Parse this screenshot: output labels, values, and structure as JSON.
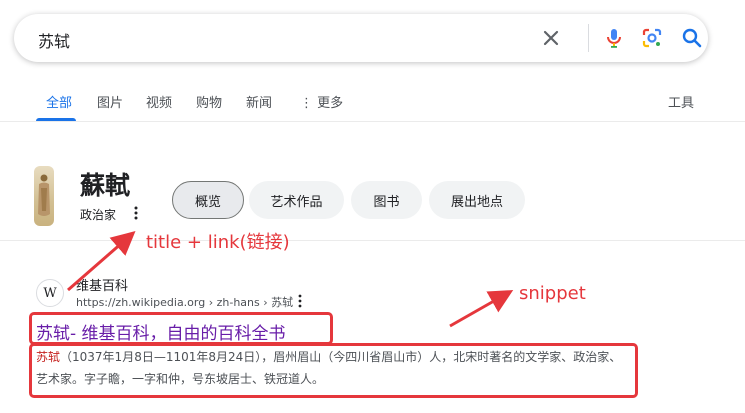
{
  "search": {
    "query": "苏轼"
  },
  "tabs": [
    {
      "label": "全部",
      "active": true
    },
    {
      "label": "图片"
    },
    {
      "label": "视频"
    },
    {
      "label": "购物"
    },
    {
      "label": "新闻"
    },
    {
      "label": "⋮ 更多"
    }
  ],
  "tools_label": "工具",
  "knowledge": {
    "title": "蘇軾",
    "subtitle": "政治家",
    "chips": [
      "概览",
      "艺术作品",
      "图书",
      "展出地点"
    ],
    "selected_chip": "概览"
  },
  "result": {
    "favicon": "W",
    "site_name": "维基百科",
    "url": "https://zh.wikipedia.org › zh-hans › 苏轼",
    "title": "苏轼- 维基百科，自由的百科全书",
    "snippet_highlight": "苏轼",
    "snippet_rest": "（1037年1月8日—1101年8月24日），眉州眉山（今四川省眉山市）人，北宋时著名的文学家、政治家、艺术家。字子瞻，一字和仲，号东坡居士、铁冠道人。"
  },
  "annotations": {
    "title_link": "title + link(链接)",
    "snippet": "snippet",
    "color": "#e5373c"
  }
}
